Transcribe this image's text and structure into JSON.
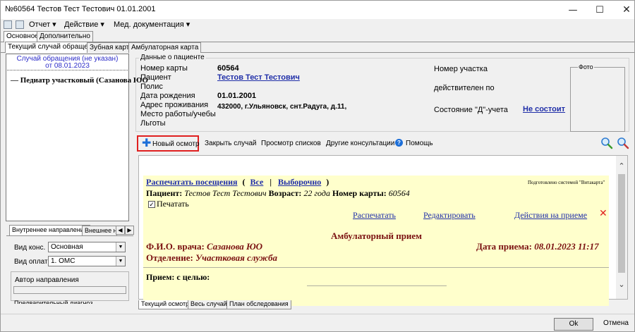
{
  "window": {
    "title": "№60564 Тестов Тест Тестович 01.01.2001",
    "controls": {
      "minimize": "—",
      "maximize": "☐",
      "close": "✕"
    }
  },
  "menu": [
    {
      "label": "Отчет ▾"
    },
    {
      "label": "Действие ▾"
    },
    {
      "label": "Мед. документация ▾"
    }
  ],
  "top_tabs": [
    {
      "label": "Основное",
      "active": true
    },
    {
      "label": "Дополнительно",
      "active": false
    }
  ],
  "sub_tabs": [
    {
      "label": "Текущий случай обращения",
      "active": true
    },
    {
      "label": "Зубная карта",
      "active": false
    },
    {
      "label": "Амбулаторная карта",
      "active": false
    }
  ],
  "case_list": {
    "header_line1": "Случай обращения (не указан)",
    "header_line2": "от 08.01.2023",
    "items": [
      "Педиатр участковый (Сазанова ЮО"
    ]
  },
  "direction_tabs": [
    {
      "label": "Внутреннее направление",
      "active": true
    },
    {
      "label": "Внешнее на",
      "active": false
    }
  ],
  "direction_form": {
    "cons_type_label": "Вид конс.",
    "cons_type_value": "Основная",
    "payment_label": "Вид оплаты",
    "payment_value": "1. ОМС",
    "author_label": "Автор направления",
    "prelim_diag_label": "Предварительный диагноз"
  },
  "patient": {
    "group_title": "Данные о пациенте",
    "card_number_label": "Номер карты",
    "card_number": "60564",
    "patient_label": "Пациент",
    "patient_name": "Тестов Тест Тестович",
    "policy_label": "Полис",
    "birth_label": "Дата рождения",
    "birth_date": "01.01.2001",
    "address_label": "Адрес проживания",
    "address": "432000, г.Ульяновск, снт.Радуга, д.11,",
    "work_label": "Место работы/учебы",
    "benefits_label": "Льготы",
    "district_label": "Номер участка",
    "valid_label": "действителен по",
    "d_status_label": "Состояние \"Д\"-учета",
    "d_status_value": "Не состоит",
    "photo_label": "Фото"
  },
  "toolbar": {
    "new_exam": "Новый осмотр",
    "close_case": "Закрыть случай",
    "view_lists": "Просмотр списков",
    "other_consults": "Другие консультации",
    "help": "Помощь"
  },
  "visit": {
    "print_visits": "Распечатать посещения",
    "paren_open": "(",
    "all": "Все",
    "sep": "|",
    "selective": "Выборочно",
    "paren_close": ")",
    "prepared_by": "Подготовлено системой \"Витакарта\"",
    "patient_label": "Пациент:",
    "patient_name": "Тестов Тест Тестович",
    "age_label": "Возраст:",
    "age": "22 года",
    "card_label": "Номер карты:",
    "card": "60564",
    "print_checkbox": "Печатать",
    "print_link": "Распечатать",
    "edit_link": "Редактировать",
    "actions_link": "Действия на приеме",
    "delete_icon": "✕",
    "reception_title": "Амбулаторный прием",
    "doctor_label": "Ф.И.О. врача:",
    "doctor": "Сазанова ЮО",
    "date_label": "Дата приема:",
    "date": "08.01.2023 11:17",
    "dept_label": "Отделение:",
    "dept": "Участковая служба",
    "purpose_label": "Прием: с целью:"
  },
  "bottom_tabs": [
    {
      "label": "Текущий осмотр",
      "active": true
    },
    {
      "label": "Весь случай",
      "active": false
    },
    {
      "label": "План обследования",
      "active": false
    }
  ],
  "footer": {
    "ok": "Ok",
    "cancel": "Отмена"
  },
  "colors": {
    "link": "#1f2ea8",
    "highlight_border": "#e02020",
    "panel_bg": "#ffffcc",
    "accent_red": "#7a1010"
  }
}
